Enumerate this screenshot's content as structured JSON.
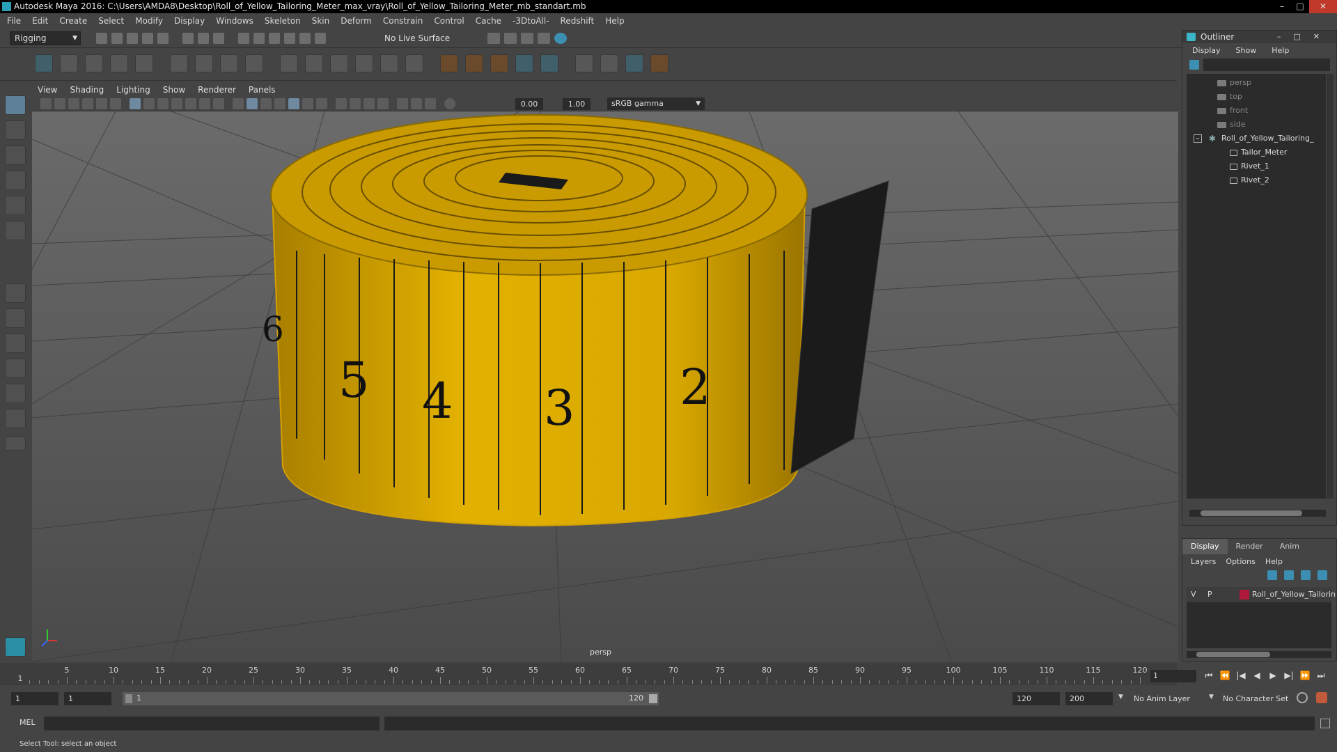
{
  "window": {
    "title": "Autodesk Maya 2016: C:\\Users\\AMDA8\\Desktop\\Roll_of_Yellow_Tailoring_Meter_max_vray\\Roll_of_Yellow_Tailoring_Meter_mb_standart.mb",
    "controls": [
      "–",
      "□",
      "✕"
    ]
  },
  "menu": [
    "File",
    "Edit",
    "Create",
    "Select",
    "Modify",
    "Display",
    "Windows",
    "Skeleton",
    "Skin",
    "Deform",
    "Constrain",
    "Control",
    "Cache",
    "-3DtoAll-",
    "Redshift",
    "Help"
  ],
  "status_line": {
    "mode": "Rigging",
    "live_surface": "No Live Surface"
  },
  "panel": {
    "menu": [
      "View",
      "Shading",
      "Lighting",
      "Show",
      "Renderer",
      "Panels"
    ],
    "exposure": "0.00",
    "gamma_value": "1.00",
    "color_space": "sRGB gamma",
    "camera": "persp"
  },
  "outliner": {
    "title": "Outliner",
    "menu": [
      "Display",
      "Show",
      "Help"
    ],
    "items": [
      {
        "label": "persp",
        "kind": "camera"
      },
      {
        "label": "top",
        "kind": "camera"
      },
      {
        "label": "front",
        "kind": "camera"
      },
      {
        "label": "side",
        "kind": "camera"
      },
      {
        "label": "Roll_of_Yellow_Tailoring_",
        "kind": "group"
      },
      {
        "label": "Tailor_Meter",
        "kind": "mesh"
      },
      {
        "label": "Rivet_1",
        "kind": "mesh"
      },
      {
        "label": "Rivet_2",
        "kind": "mesh"
      }
    ]
  },
  "layers": {
    "tabs": [
      "Display",
      "Render",
      "Anim"
    ],
    "active_tab": "Display",
    "menu": [
      "Layers",
      "Options",
      "Help"
    ],
    "row": {
      "v": "V",
      "p": "P",
      "name": "Roll_of_Yellow_Tailorin",
      "color": "#b01a3a"
    }
  },
  "timeline": {
    "ticks": [
      5,
      10,
      15,
      20,
      25,
      30,
      35,
      40,
      45,
      50,
      55,
      60,
      65,
      70,
      75,
      80,
      85,
      90,
      95,
      100,
      105,
      110,
      115,
      120
    ],
    "start_marker": "1",
    "current_frame": "1",
    "play_controls": [
      "⏮",
      "⏪",
      "|◀",
      "◀",
      "▶",
      "▶|",
      "⏩",
      "⏭"
    ]
  },
  "range": {
    "start": "1",
    "anim_start": "1",
    "slider_start": "1",
    "slider_end": "120",
    "playback_end": "120",
    "anim_end": "200",
    "anim_layer": "No Anim Layer",
    "character_set": "No Character Set"
  },
  "command": {
    "language": "MEL",
    "help": "Select Tool: select an object"
  }
}
